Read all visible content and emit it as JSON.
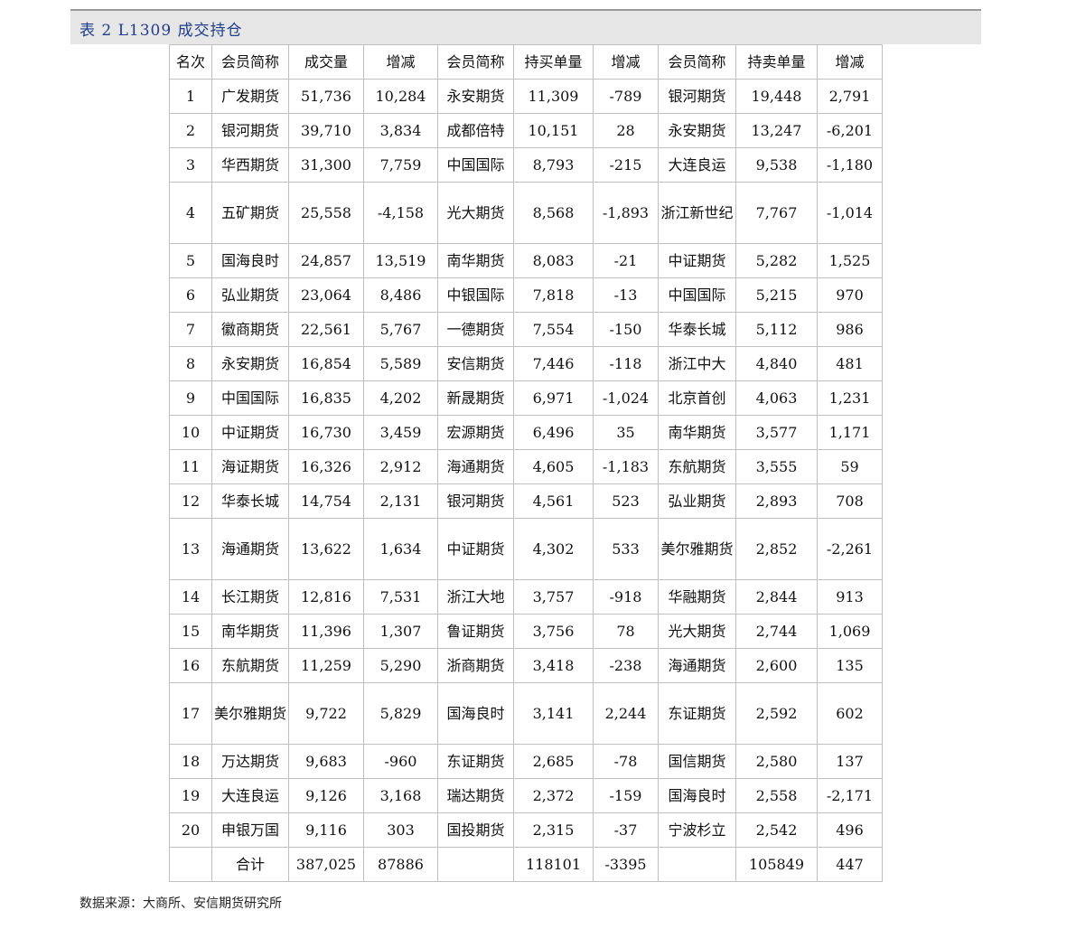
{
  "title": "表 2 L1309 成交持仓",
  "headers": [
    "名次",
    "会员简称",
    "成交量",
    "增减",
    "会员简称",
    "持买单量",
    "增减",
    "会员简称",
    "持卖单量",
    "增减"
  ],
  "rows": [
    [
      "1",
      "广发期货",
      "51,736",
      "10,284",
      "永安期货",
      "11,309",
      "-789",
      "银河期货",
      "19,448",
      "2,791"
    ],
    [
      "2",
      "银河期货",
      "39,710",
      "3,834",
      "成都倍特",
      "10,151",
      "28",
      "永安期货",
      "13,247",
      "-6,201"
    ],
    [
      "3",
      "华西期货",
      "31,300",
      "7,759",
      "中国国际",
      "8,793",
      "-215",
      "大连良运",
      "9,538",
      "-1,180"
    ],
    [
      "4",
      "五矿期货",
      "25,558",
      "-4,158",
      "光大期货",
      "8,568",
      "-1,893",
      "浙江新世纪",
      "7,767",
      "-1,014"
    ],
    [
      "5",
      "国海良时",
      "24,857",
      "13,519",
      "南华期货",
      "8,083",
      "-21",
      "中证期货",
      "5,282",
      "1,525"
    ],
    [
      "6",
      "弘业期货",
      "23,064",
      "8,486",
      "中银国际",
      "7,818",
      "-13",
      "中国国际",
      "5,215",
      "970"
    ],
    [
      "7",
      "徽商期货",
      "22,561",
      "5,767",
      "一德期货",
      "7,554",
      "-150",
      "华泰长城",
      "5,112",
      "986"
    ],
    [
      "8",
      "永安期货",
      "16,854",
      "5,589",
      "安信期货",
      "7,446",
      "-118",
      "浙江中大",
      "4,840",
      "481"
    ],
    [
      "9",
      "中国国际",
      "16,835",
      "4,202",
      "新晟期货",
      "6,971",
      "-1,024",
      "北京首创",
      "4,063",
      "1,231"
    ],
    [
      "10",
      "中证期货",
      "16,730",
      "3,459",
      "宏源期货",
      "6,496",
      "35",
      "南华期货",
      "3,577",
      "1,171"
    ],
    [
      "11",
      "海证期货",
      "16,326",
      "2,912",
      "海通期货",
      "4,605",
      "-1,183",
      "东航期货",
      "3,555",
      "59"
    ],
    [
      "12",
      "华泰长城",
      "14,754",
      "2,131",
      "银河期货",
      "4,561",
      "523",
      "弘业期货",
      "2,893",
      "708"
    ],
    [
      "13",
      "海通期货",
      "13,622",
      "1,634",
      "中证期货",
      "4,302",
      "533",
      "美尔雅期货",
      "2,852",
      "-2,261"
    ],
    [
      "14",
      "长江期货",
      "12,816",
      "7,531",
      "浙江大地",
      "3,757",
      "-918",
      "华融期货",
      "2,844",
      "913"
    ],
    [
      "15",
      "南华期货",
      "11,396",
      "1,307",
      "鲁证期货",
      "3,756",
      "78",
      "光大期货",
      "2,744",
      "1,069"
    ],
    [
      "16",
      "东航期货",
      "11,259",
      "5,290",
      "浙商期货",
      "3,418",
      "-238",
      "海通期货",
      "2,600",
      "135"
    ],
    [
      "17",
      "美尔雅期货",
      "9,722",
      "5,829",
      "国海良时",
      "3,141",
      "2,244",
      "东证期货",
      "2,592",
      "602"
    ],
    [
      "18",
      "万达期货",
      "9,683",
      "-960",
      "东证期货",
      "2,685",
      "-78",
      "国信期货",
      "2,580",
      "137"
    ],
    [
      "19",
      "大连良运",
      "9,126",
      "3,168",
      "瑞达期货",
      "2,372",
      "-159",
      "国海良时",
      "2,558",
      "-2,171"
    ],
    [
      "20",
      "申银万国",
      "9,116",
      "303",
      "国投期货",
      "2,315",
      "-37",
      "宁波杉立",
      "2,542",
      "496"
    ]
  ],
  "total": [
    "",
    "合计",
    "387,025",
    "87886",
    "",
    "118101",
    "-3395",
    "",
    "105849",
    "447"
  ],
  "source": "数据来源：大商所、安信期货研究所"
}
